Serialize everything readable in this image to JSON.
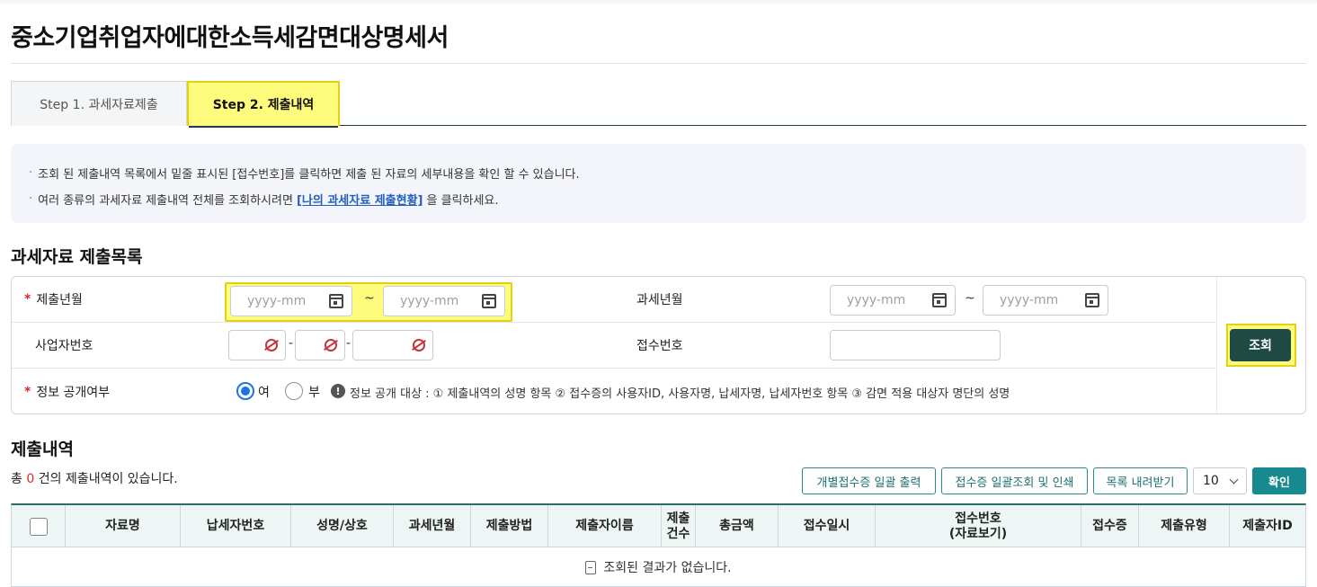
{
  "page": {
    "title": "중소기업취업자에대한소득세감면대상명세서"
  },
  "tabs": [
    {
      "label": "Step 1. 과세자료제출"
    },
    {
      "label": "Step 2. 제출내역"
    }
  ],
  "info": {
    "line1": "조회 된 제출내역 목록에서 밑줄 표시된 [접수번호]를 클릭하면 제출 된 자료의 세부내용을 확인 할 수 있습니다.",
    "line2_prefix": "여러 종류의 과세자료 제출내역 전체를 조회하시려면",
    "line2_link": "[나의 과세자료 제출현황]",
    "line2_suffix": "을 클릭하세요."
  },
  "search": {
    "section_title": "과세자료 제출목록",
    "submit_month_label": "제출년월",
    "tax_month_label": "과세년월",
    "biz_no_label": "사업자번호",
    "receipt_no_label": "접수번호",
    "disclosure_label": "정보 공개여부",
    "date_placeholder": "yyyy-mm",
    "tilde": "~",
    "dash": "-",
    "radio_yes": "여",
    "radio_no": "부",
    "notice_mark": "!",
    "notice": "정보 공개 대상 : ① 제출내역의 성명 항목 ② 접수증의 사용자ID, 사용자명, 납세자명, 납세자번호 항목 ③ 감면 적용 대상자 명단의 성명",
    "search_button": "조회"
  },
  "results": {
    "section_title": "제출내역",
    "total_prefix": "총",
    "total_count": "0",
    "total_suffix": "건의 제출내역이 있습니다.",
    "btn_print": "개별접수증 일괄 출력",
    "btn_receipt": "접수증 일괄조회 및 인쇄",
    "btn_download": "목록 내려받기",
    "page_size": "10",
    "btn_confirm": "확인",
    "columns": [
      "자료명",
      "납세자번호",
      "성명/상호",
      "과세년월",
      "제출방법",
      "제출자이름",
      "제출\n건수",
      "총금액",
      "접수일시",
      "접수번호\n(자료보기)",
      "접수증",
      "제출유형",
      "제출자ID"
    ],
    "empty_message": "조회된 결과가 없습니다."
  }
}
